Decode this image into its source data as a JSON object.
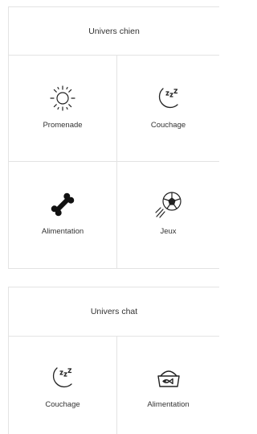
{
  "dog_section": {
    "title": "Univers chien",
    "tiles": [
      {
        "label": "Promenade",
        "icon": "sun-icon"
      },
      {
        "label": "Couchage",
        "icon": "moon-sleep-icon"
      },
      {
        "label": "Alimentation",
        "icon": "bone-icon"
      },
      {
        "label": "Jeux",
        "icon": "ball-icon"
      }
    ]
  },
  "cat_section": {
    "title": "Univers chat",
    "tiles": [
      {
        "label": "Couchage",
        "icon": "moon-sleep-icon"
      },
      {
        "label": "Alimentation",
        "icon": "food-bowl-icon"
      }
    ]
  }
}
